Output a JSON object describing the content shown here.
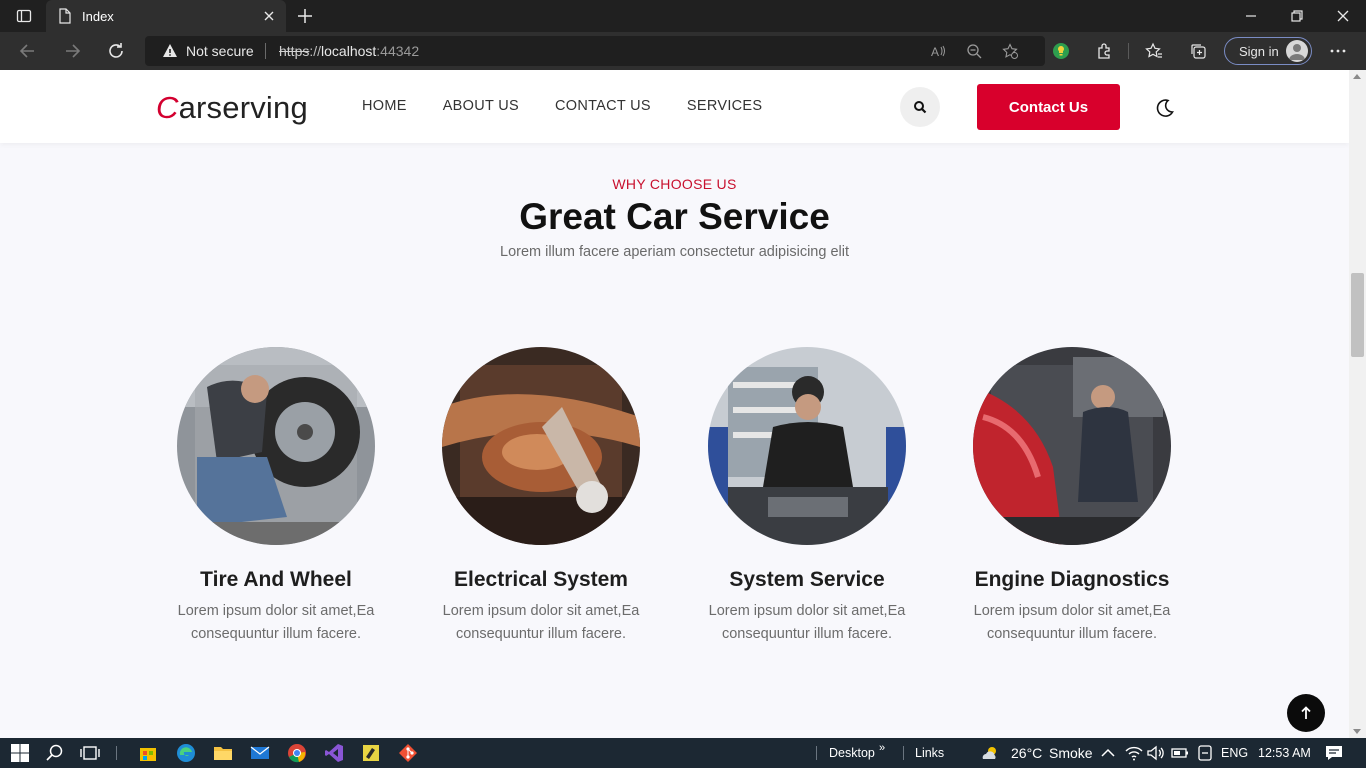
{
  "browser": {
    "tab_title": "Index",
    "security_text": "Not secure",
    "url_scheme": "https",
    "url_sep": "://",
    "url_host": "localhost",
    "url_port": ":44342",
    "signin_label": "Sign in"
  },
  "site": {
    "logo_initial": "C",
    "logo_rest": "arserving",
    "nav": [
      "HOME",
      "ABOUT US",
      "CONTACT US",
      "SERVICES"
    ],
    "contact_button": "Contact Us"
  },
  "section": {
    "subtitle": "WHY CHOOSE US",
    "title": "Great Car Service",
    "description": "Lorem illum facere aperiam consectetur adipisicing elit"
  },
  "services": [
    {
      "title": "Tire And Wheel",
      "desc_line1": "Lorem ipsum dolor sit amet,Ea",
      "desc_line2": "consequuntur illum facere."
    },
    {
      "title": "Electrical System",
      "desc_line1": "Lorem ipsum dolor sit amet,Ea",
      "desc_line2": "consequuntur illum facere."
    },
    {
      "title": "System Service",
      "desc_line1": "Lorem ipsum dolor sit amet,Ea",
      "desc_line2": "consequuntur illum facere."
    },
    {
      "title": "Engine Diagnostics",
      "desc_line1": "Lorem ipsum dolor sit amet,Ea",
      "desc_line2": "consequuntur illum facere."
    }
  ],
  "taskbar": {
    "desktop_label": "Desktop",
    "links_label": "Links",
    "weather_temp": "26°C",
    "weather_text": "Smoke",
    "language": "ENG",
    "time": "12:53 AM"
  },
  "colors": {
    "accent": "#d8002c",
    "page_bg": "#f8f8fc",
    "taskbar_bg": "#1c2833"
  }
}
